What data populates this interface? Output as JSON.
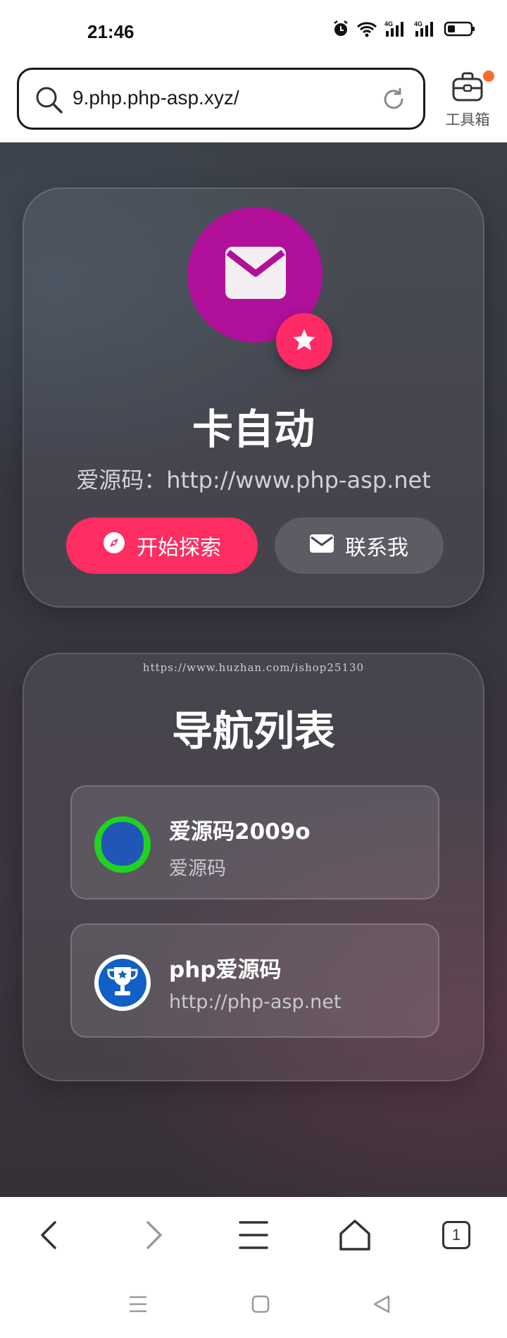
{
  "status_bar": {
    "time": "21:46",
    "icons": [
      "alarm-icon",
      "wifi-icon",
      "signal-4g-icon",
      "signal-4g-icon",
      "battery-icon"
    ]
  },
  "address_bar": {
    "url": "9.php.php-asp.xyz/",
    "search_icon": "search-icon",
    "reload_icon": "reload-icon"
  },
  "toolbox": {
    "label": "工具箱",
    "icon": "toolbox-icon",
    "notification_color": "#ff6a2b"
  },
  "profile": {
    "title": "卡自动",
    "subtitle": "爱源码：http://www.php-asp.net",
    "avatar_color": "#b0109a",
    "badge_color": "#ff2b65",
    "explore_button": "开始探索",
    "contact_button": "联系我",
    "accent": "#fe2d62"
  },
  "nav": {
    "watermark": "https://www.huzhan.com/ishop25130",
    "title": "导航列表",
    "items": [
      {
        "name": "爱源码2009o",
        "desc": "爱源码",
        "icon": "shield-icon"
      },
      {
        "name": "php爱源码",
        "desc": "http://php-asp.net",
        "icon": "trophy-icon"
      }
    ]
  },
  "browser_toolbar": {
    "tab_count": "1",
    "icons": [
      "back-icon",
      "forward-icon",
      "menu-icon",
      "home-icon",
      "tabs-icon"
    ]
  },
  "system_nav": {
    "icons": [
      "recents-icon",
      "home-icon",
      "back-icon"
    ]
  }
}
